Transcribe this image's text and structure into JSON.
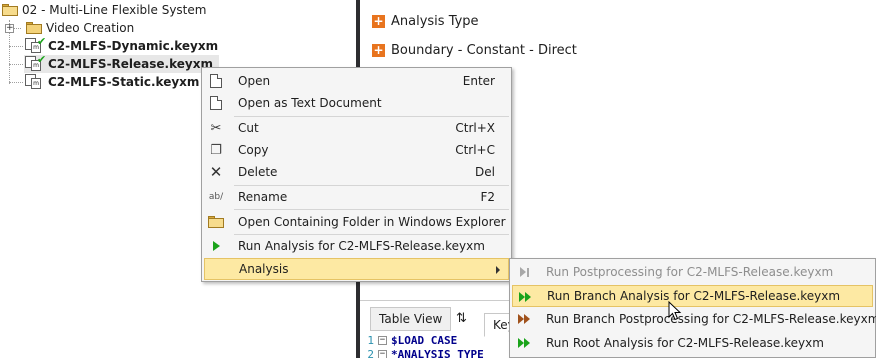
{
  "tree": {
    "root": "02 - Multi-Line Flexible System",
    "folder": "Video Creation",
    "files": [
      "C2-MLFS-Dynamic.keyxm",
      "C2-MLFS-Release.keyxm",
      "C2-MLFS-Static.keyxm"
    ]
  },
  "props": {
    "rows": [
      "Analysis Type",
      "Boundary - Constant - Direct"
    ]
  },
  "editor": {
    "tabs": [
      "Table View",
      "Key"
    ],
    "sort_icon": "⇅",
    "lines": [
      {
        "num": "1",
        "text": "$LOAD CASE"
      },
      {
        "num": "2",
        "text": "*ANALYSIS TYPE"
      }
    ]
  },
  "context_menu": {
    "items": [
      {
        "label": "Open",
        "shortcut": "Enter",
        "icon": "document-icon"
      },
      {
        "label": "Open as Text Document",
        "shortcut": "",
        "icon": "document-icon"
      },
      {
        "label": "Cut",
        "shortcut": "Ctrl+X",
        "icon": "scissors-icon"
      },
      {
        "label": "Copy",
        "shortcut": "Ctrl+C",
        "icon": "copy-icon"
      },
      {
        "label": "Delete",
        "shortcut": "Del",
        "icon": "delete-x-icon"
      },
      {
        "label": "Rename",
        "shortcut": "F2",
        "icon": "rename-icon"
      },
      {
        "label": "Open Containing Folder in Windows Explorer",
        "shortcut": "",
        "icon": "folder-open-icon"
      },
      {
        "label": "Run Analysis for C2-MLFS-Release.keyxm",
        "shortcut": "",
        "icon": "play-icon"
      },
      {
        "label": "Analysis",
        "shortcut": "",
        "icon": ""
      }
    ]
  },
  "submenu": {
    "items": [
      {
        "label": "Run Postprocessing for C2-MLFS-Release.keyxm",
        "enabled": false
      },
      {
        "label": "Run Branch Analysis for C2-MLFS-Release.keyxm",
        "enabled": true
      },
      {
        "label": "Run Branch Postprocessing for C2-MLFS-Release.keyxm",
        "enabled": true
      },
      {
        "label": "Run Root Analysis for C2-MLFS-Release.keyxm",
        "enabled": true
      }
    ]
  },
  "colors": {
    "accent_orange": "#e8741e",
    "highlight": "#fde9a3",
    "play_green": "#1aa31a",
    "play_brown": "#a0521c",
    "check_green": "#1aa31a",
    "divider": "#2d2d30"
  }
}
